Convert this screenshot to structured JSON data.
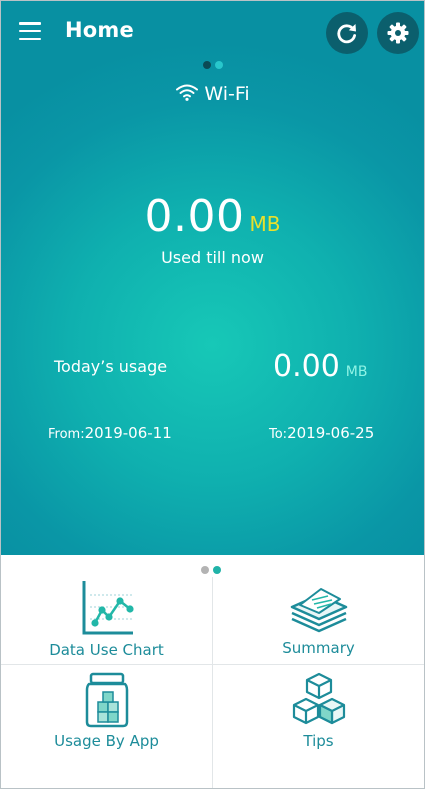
{
  "header": {
    "title": "Home",
    "menu_icon": "hamburger-menu-icon",
    "refresh_icon": "refresh-icon",
    "settings_icon": "gear-icon"
  },
  "network": {
    "label": "Wi-Fi",
    "icon": "wifi-icon"
  },
  "usage": {
    "value": "0.00",
    "unit": "MB",
    "label": "Used till now"
  },
  "today": {
    "label": "Today’s usage",
    "value": "0.00",
    "unit": "MB"
  },
  "period": {
    "from_label": "From:",
    "from_date": "2019-06-11",
    "to_label": "To:",
    "to_date": "2019-06-25"
  },
  "tiles": [
    {
      "label": "Data Use Chart",
      "icon": "line-chart-icon"
    },
    {
      "label": "Summary",
      "icon": "stacked-papers-icon"
    },
    {
      "label": "Usage By App",
      "icon": "jar-cubes-icon"
    },
    {
      "label": "Tips",
      "icon": "stacked-cubes-icon"
    }
  ],
  "colors": {
    "accent": "#1d8c9a",
    "hero_center": "#17c8b7",
    "hero_edge": "#0890a2",
    "unit_yellow": "#e9e02c",
    "unit_mint": "#8ff3e5"
  }
}
